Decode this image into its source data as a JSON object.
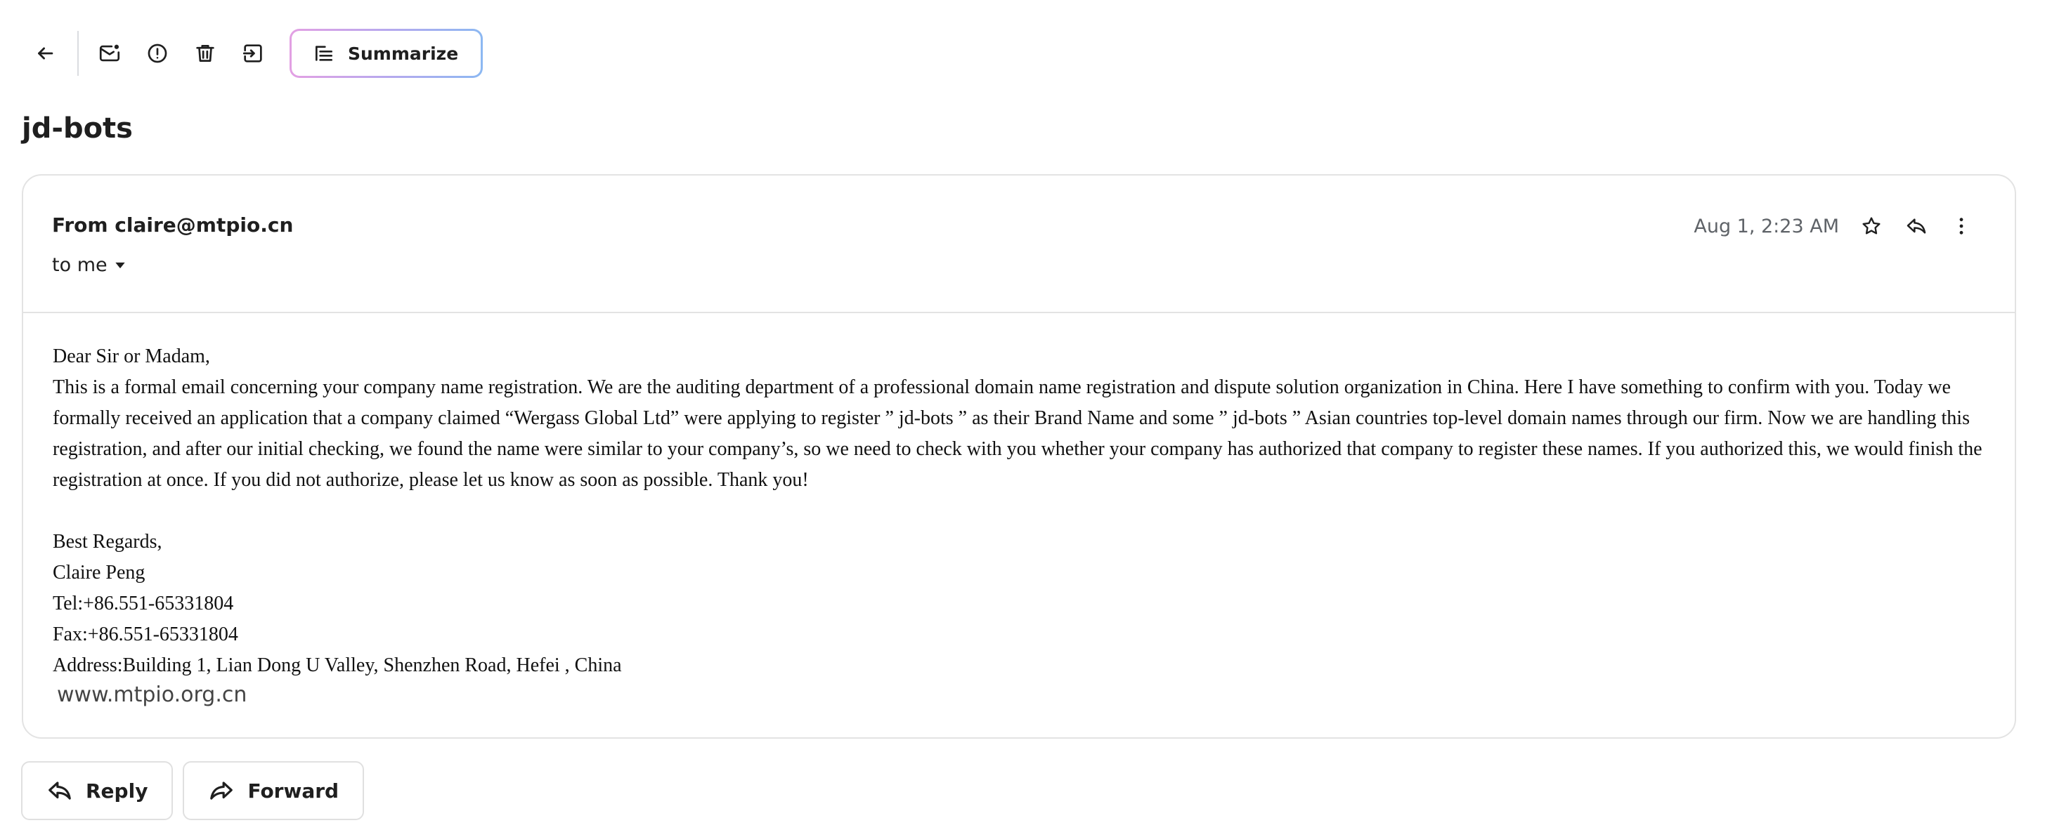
{
  "toolbar": {
    "icons": {
      "back": "arrow-left-icon",
      "mark_unread": "mail-unread-icon",
      "spam": "report-spam-icon",
      "delete": "trash-icon",
      "move": "move-to-icon",
      "summarize": "summarize-icon"
    },
    "summarize_label": "Summarize"
  },
  "email": {
    "subject": "jd-bots",
    "from_line": "From claire@mtpio.cn",
    "to_label": "to me",
    "date": "Aug 1, 2:23 AM",
    "body": {
      "greeting": "Dear Sir or Madam,",
      "paragraph": "This is a formal email concerning your company name registration. We are the auditing department of a professional domain name registration and dispute solution organization in China. Here I have something to confirm with you. Today we formally received an application that a company claimed “Wergass Global Ltd” were applying to register ” jd-bots ” as their Brand Name and some ” jd-bots ” Asian countries top-level domain names through our firm. Now we are handling this registration, and after our initial checking, we found the name were similar to your company’s, so we need to check with you whether your company has authorized that company to register these names. If you authorized this, we would finish the registration at once. If you did not authorize, please let us know as soon as possible. Thank you!",
      "closing": "Best Regards,",
      "name": "Claire Peng",
      "tel": "Tel:+86.551-65331804",
      "fax": "Fax:+86.551-65331804",
      "address": "Address:Building 1, Lian Dong U Valley, Shenzhen Road, Hefei , China",
      "website": "www.mtpio.org.cn"
    }
  },
  "actions": {
    "reply_label": "Reply",
    "forward_label": "Forward"
  },
  "colors": {
    "text": "#1f1f1f",
    "muted": "#5f6368",
    "border": "#e3e3e3",
    "summarize_gradient_start": "#e3a0e3",
    "summarize_gradient_end": "#8cb8f2"
  }
}
